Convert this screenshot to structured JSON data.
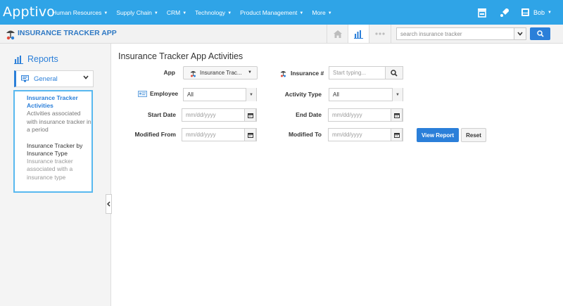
{
  "topnav": {
    "brand": "Apptivo",
    "menu": [
      "Human Resources",
      "Supply Chain",
      "CRM",
      "Technology",
      "Product Management",
      "More"
    ],
    "user": "Bob",
    "icons": [
      "store-icon",
      "rocket-icon",
      "user-avatar-icon"
    ]
  },
  "appbar": {
    "title": "INSURANCE TRACKER APP",
    "search_placeholder": "search insurance tracker",
    "tools": [
      "home-icon",
      "reports-icon",
      "more-icon"
    ]
  },
  "sidebar": {
    "heading": "Reports",
    "group": "General",
    "reports": [
      {
        "title": "Insurance Tracker Activities",
        "desc": "Activities associated with insurance tracker in a period",
        "active": true
      },
      {
        "title": "Insurance Tracker by Insurance Type",
        "desc": "Insurance tracker associated with a insurance type",
        "active": false
      }
    ]
  },
  "form": {
    "page_title": "Insurance Tracker App Activities",
    "app_label": "App",
    "app_value": "Insurance Trac...",
    "insurance_label": "Insurance #",
    "insurance_placeholder": "Start typing...",
    "employee_label": "Employee",
    "employee_value": "All",
    "activity_label": "Activity Type",
    "activity_value": "All",
    "start_label": "Start Date",
    "start_placeholder": "mm/dd/yyyy",
    "end_label": "End Date",
    "end_placeholder": "mm/dd/yyyy",
    "modified_from_label": "Modified From",
    "modified_from_placeholder": "mm/dd/yyyy",
    "modified_to_label": "Modified To",
    "modified_to_placeholder": "mm/dd/yyyy",
    "view_report": "View Report",
    "reset": "Reset"
  },
  "colors": {
    "topnav": "#2fa4e7",
    "accent": "#2b7fd9",
    "title": "#2f79c4",
    "sidebar_bg": "#f4f4f4",
    "list_border": "#58b8ef"
  }
}
